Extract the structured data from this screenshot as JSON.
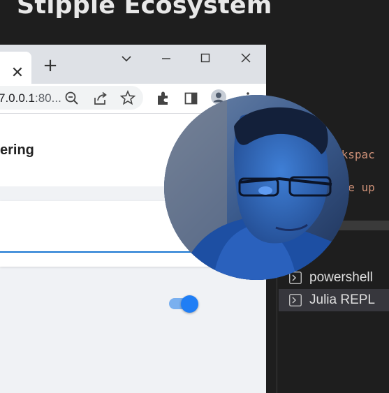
{
  "slide": {
    "title": "Stipple Ecosystem"
  },
  "browser": {
    "tab_close_glyph": "✕",
    "new_tab_glyph": "+",
    "url_host": "7.0.0.1",
    "url_port": ":80...",
    "icons": [
      "zoom-out-icon",
      "share-icon",
      "star-icon",
      "extensions-icon",
      "side-panel-icon",
      "profile-icon",
      "menu-icon"
    ]
  },
  "page": {
    "heading": "ering",
    "toggle_on": true
  },
  "editor": {
    "code_line_1": "ckspac",
    "code_line_2": "ire up"
  },
  "terminal": {
    "items": [
      {
        "label": "powershell",
        "icon": "terminal-icon"
      },
      {
        "label": "Julia REPL",
        "icon": "terminal-icon",
        "selected": true
      }
    ]
  },
  "colors": {
    "accent": "#1976d2",
    "toggle_thumb": "#1f7ef5",
    "code_string": "#ce9178"
  }
}
